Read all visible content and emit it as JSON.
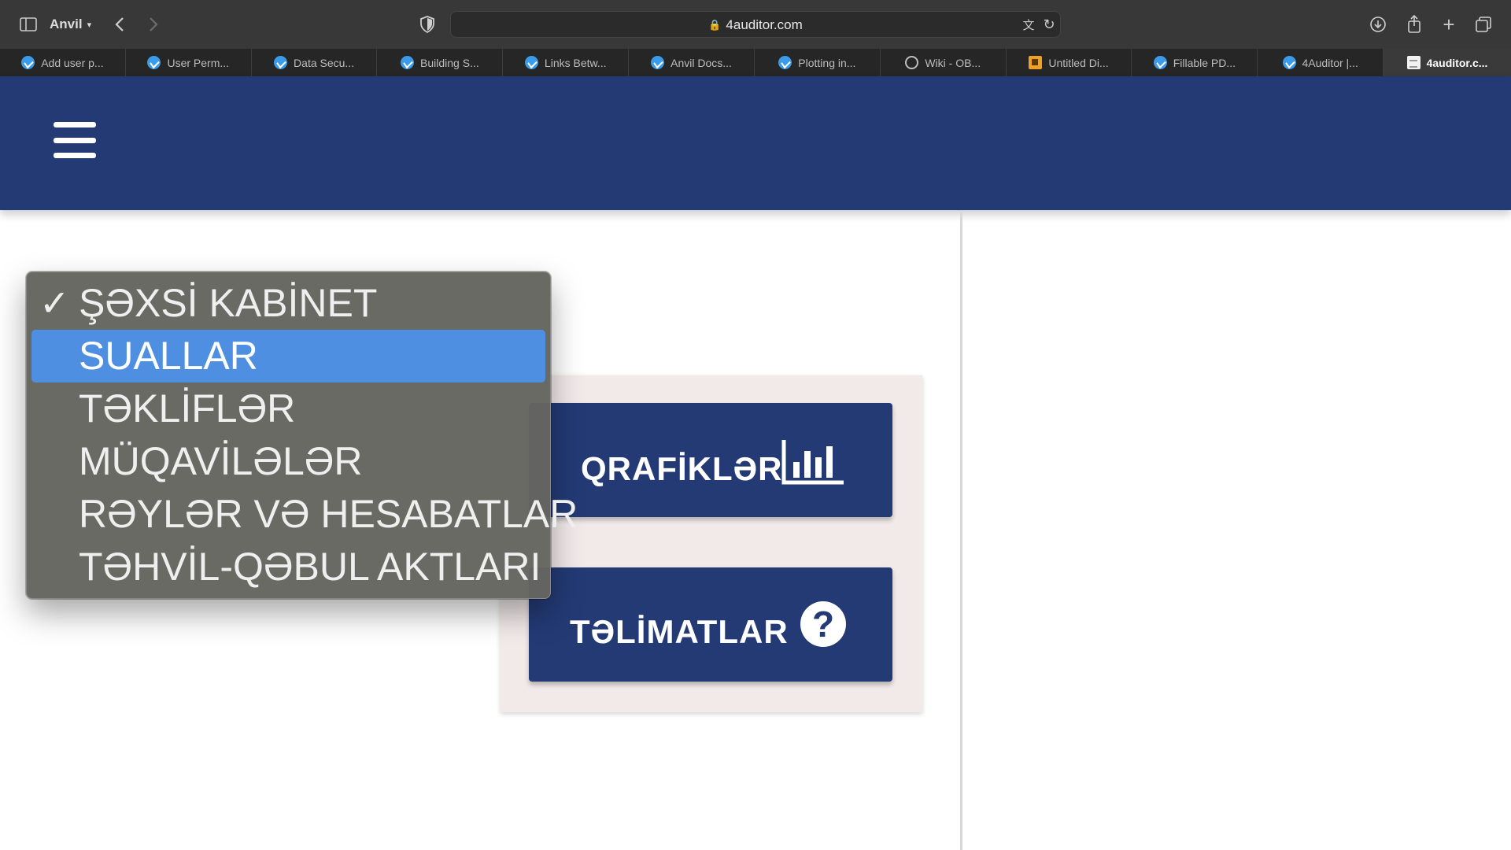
{
  "browser": {
    "profile_name": "Anvil",
    "url": "4auditor.com",
    "tabs": [
      {
        "label": "Add user p...",
        "icon": "anvil-icon"
      },
      {
        "label": "User Perm...",
        "icon": "anvil-icon"
      },
      {
        "label": "Data Secu...",
        "icon": "anvil-icon"
      },
      {
        "label": "Building S...",
        "icon": "anvil-icon"
      },
      {
        "label": "Links Betw...",
        "icon": "anvil-icon"
      },
      {
        "label": "Anvil Docs...",
        "icon": "anvil-icon"
      },
      {
        "label": "Plotting in...",
        "icon": "anvil-icon"
      },
      {
        "label": "Wiki - OB...",
        "icon": "wiki-icon"
      },
      {
        "label": "Untitled Di...",
        "icon": "diagram-icon"
      },
      {
        "label": "Fillable PD...",
        "icon": "anvil-icon"
      },
      {
        "label": "4Auditor |...",
        "icon": "anvil-icon"
      },
      {
        "label": "4auditor.c...",
        "icon": "page-icon",
        "active": true
      }
    ]
  },
  "dropdown": {
    "items": [
      {
        "label": "ŞƏXSİ KABİNET",
        "checked": true
      },
      {
        "label": "SUALLAR",
        "highlighted": true
      },
      {
        "label": "TƏKLİFLƏR"
      },
      {
        "label": "MÜQAVİLƏLƏR"
      },
      {
        "label": "RƏYLƏR VƏ HESABATLAR"
      },
      {
        "label": "TƏHVİL-QƏBUL AKTLARI"
      }
    ]
  },
  "main": {
    "graphs_button": "QRAFİKLƏR",
    "help_button": "TƏLİMATLAR",
    "help_icon_glyph": "?"
  },
  "colors": {
    "brand_navy": "#233a75",
    "card_bg": "#f2eae9",
    "highlight_blue": "#4f8fe2"
  }
}
